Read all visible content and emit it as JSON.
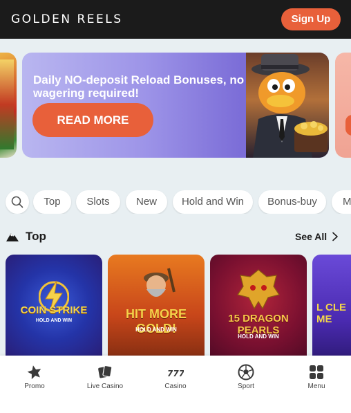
{
  "header": {
    "logo_text": "GOLDEN REELS",
    "signup_label": "Sign Up",
    "accent_color": "#e8603a"
  },
  "banner": {
    "headline": "Daily NO-deposit Reload Bonuses, no wagering required!",
    "cta_label": "READ MORE"
  },
  "filters": {
    "search_icon": "search-icon",
    "chips": [
      "Top",
      "Slots",
      "New",
      "Hold and Win",
      "Bonus-buy",
      "M"
    ]
  },
  "section": {
    "title": "Top",
    "icon": "mountain-icon",
    "see_all_label": "See All"
  },
  "games": [
    {
      "line1": "COIN STRIKE",
      "line2": "HOLD AND WIN"
    },
    {
      "line1": "HIT MORE GOLD!",
      "line2": "HOLD AND WIN"
    },
    {
      "line1": "15 DRAGON PEARLS",
      "line2": "HOLD AND WIN"
    },
    {
      "line1": "L CLE ME",
      "line2": ""
    }
  ],
  "bottom_nav": [
    {
      "label": "Promo",
      "icon": "star-icon"
    },
    {
      "label": "Live Casino",
      "icon": "cards-icon"
    },
    {
      "label": "Casino",
      "icon": "slot-777-icon"
    },
    {
      "label": "Sport",
      "icon": "soccer-ball-icon"
    },
    {
      "label": "Menu",
      "icon": "grid-icon"
    }
  ]
}
